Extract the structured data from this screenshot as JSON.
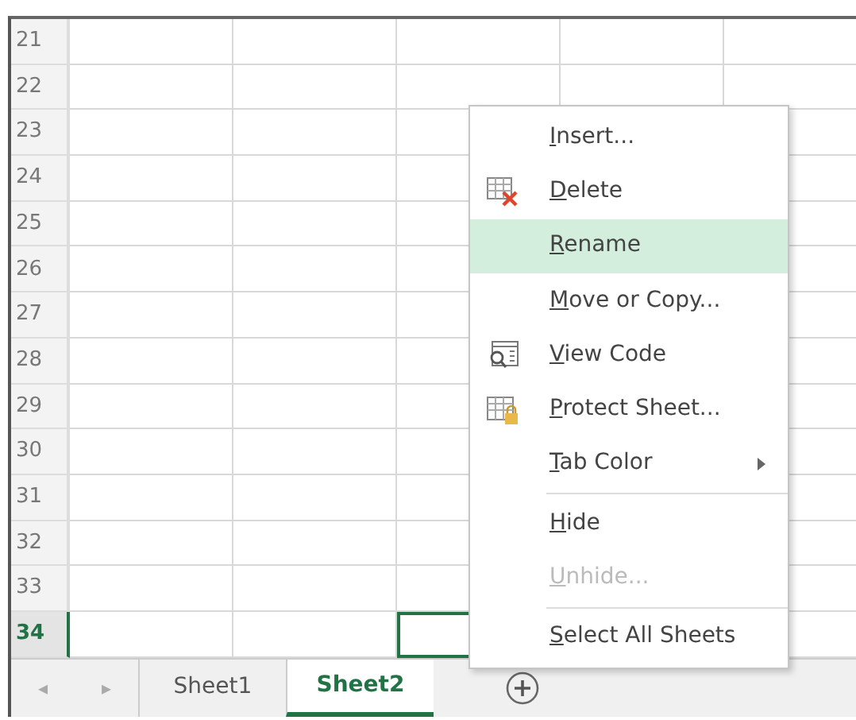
{
  "grid": {
    "rows": [
      {
        "header": "21",
        "active": false,
        "cells": [
          {
            "selected": false
          },
          {
            "selected": false
          },
          {
            "selected": false
          },
          {
            "selected": false
          },
          {
            "selected": false
          }
        ]
      },
      {
        "header": "22",
        "active": false,
        "cells": [
          {
            "selected": false
          },
          {
            "selected": false
          },
          {
            "selected": false
          },
          {
            "selected": false
          },
          {
            "selected": false
          }
        ]
      },
      {
        "header": "23",
        "active": false,
        "cells": [
          {
            "selected": false
          },
          {
            "selected": false
          },
          {
            "selected": false
          },
          null,
          {
            "selected": false
          }
        ]
      },
      {
        "header": "24",
        "active": false,
        "cells": [
          {
            "selected": false
          },
          {
            "selected": false
          },
          {
            "selected": false
          },
          null,
          {
            "selected": false
          }
        ]
      },
      {
        "header": "25",
        "active": false,
        "cells": [
          {
            "selected": false
          },
          {
            "selected": false
          },
          {
            "selected": false
          },
          null,
          {
            "selected": false
          }
        ]
      },
      {
        "header": "26",
        "active": false,
        "cells": [
          {
            "selected": false
          },
          {
            "selected": false
          },
          {
            "selected": false
          },
          null,
          {
            "selected": false
          }
        ]
      },
      {
        "header": "27",
        "active": false,
        "cells": [
          {
            "selected": false
          },
          {
            "selected": false
          },
          {
            "selected": false
          },
          null,
          {
            "selected": false
          }
        ]
      },
      {
        "header": "28",
        "active": false,
        "cells": [
          {
            "selected": false
          },
          {
            "selected": false
          },
          {
            "selected": false
          },
          null,
          {
            "selected": false
          }
        ]
      },
      {
        "header": "29",
        "active": false,
        "cells": [
          {
            "selected": false
          },
          {
            "selected": false
          },
          {
            "selected": false
          },
          null,
          {
            "selected": false
          }
        ]
      },
      {
        "header": "30",
        "active": false,
        "cells": [
          {
            "selected": false
          },
          {
            "selected": false
          },
          {
            "selected": false
          },
          null,
          {
            "selected": false
          }
        ]
      },
      {
        "header": "31",
        "active": false,
        "cells": [
          {
            "selected": false
          },
          {
            "selected": false
          },
          {
            "selected": false
          },
          null,
          {
            "selected": false
          }
        ]
      },
      {
        "header": "32",
        "active": false,
        "cells": [
          {
            "selected": false
          },
          {
            "selected": false
          },
          {
            "selected": false
          },
          null,
          {
            "selected": false
          }
        ]
      },
      {
        "header": "33",
        "active": false,
        "cells": [
          {
            "selected": false
          },
          {
            "selected": false
          },
          {
            "selected": false
          },
          null,
          {
            "selected": false
          }
        ]
      },
      {
        "header": "34",
        "active": true,
        "cells": [
          {
            "selected": false
          },
          {
            "selected": false
          },
          {
            "selected": true
          },
          null,
          {
            "selected": false
          }
        ]
      }
    ]
  },
  "sheet_tabs": {
    "scroll_left": "◂",
    "scroll_right": "▸",
    "tabs": [
      {
        "label": "Sheet1",
        "selected": false
      },
      {
        "label": "Sheet2",
        "selected": true
      }
    ]
  },
  "context_menu": {
    "items": [
      {
        "label": "Insert...",
        "kind": "plain",
        "mnemonic": true,
        "highlighted": false,
        "disabled": false
      },
      {
        "label": "Delete",
        "kind": "delete",
        "mnemonic": true,
        "highlighted": false,
        "disabled": false
      },
      {
        "label": "Rename",
        "kind": "plain",
        "mnemonic": true,
        "highlighted": true,
        "disabled": false
      },
      {
        "label": "Move or Copy...",
        "kind": "plain",
        "mnemonic": true,
        "highlighted": false,
        "disabled": false
      },
      {
        "label": "View Code",
        "kind": "view-code",
        "mnemonic": true,
        "highlighted": false,
        "disabled": false
      },
      {
        "label": "Protect Sheet...",
        "kind": "protect",
        "mnemonic": true,
        "highlighted": false,
        "disabled": false
      },
      {
        "label": "Tab Color",
        "kind": "submenu",
        "mnemonic": true,
        "highlighted": false,
        "disabled": false
      },
      {
        "kind": "separator"
      },
      {
        "label": "Hide",
        "kind": "plain",
        "mnemonic": true,
        "highlighted": false,
        "disabled": false
      },
      {
        "label": "Unhide...",
        "kind": "plain",
        "mnemonic": true,
        "highlighted": false,
        "disabled": true
      },
      {
        "kind": "separator"
      },
      {
        "label": "Select All Sheets",
        "kind": "plain",
        "mnemonic": true,
        "highlighted": false,
        "disabled": false
      }
    ]
  }
}
